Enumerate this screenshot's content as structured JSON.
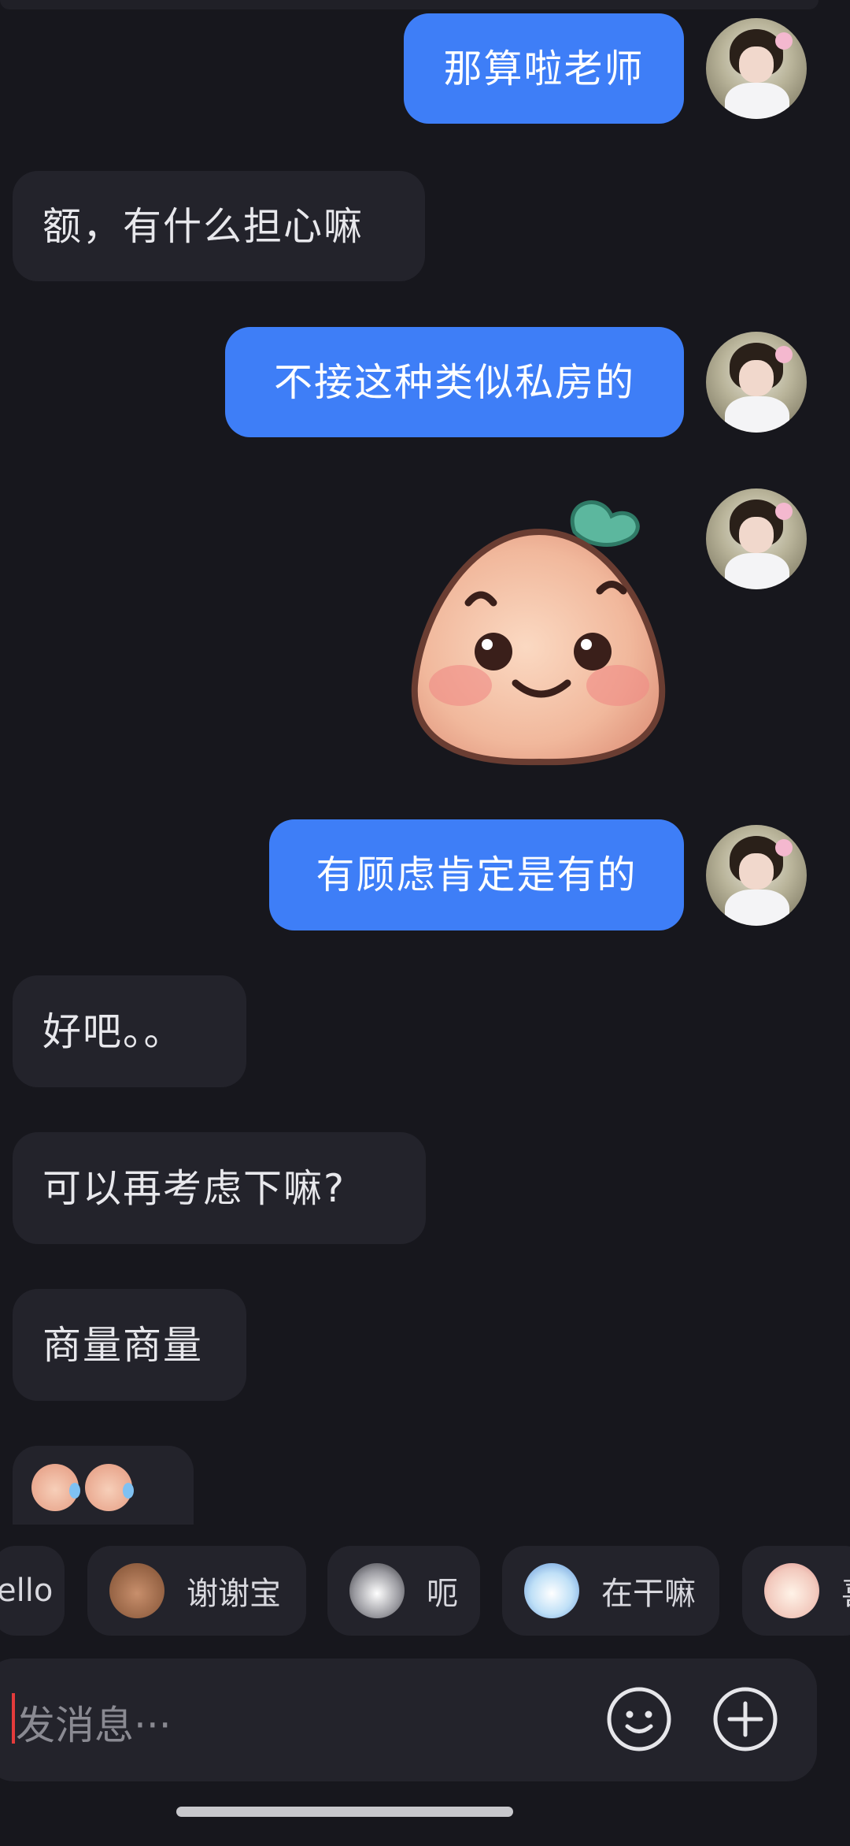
{
  "messages": {
    "m1": "那算啦老师",
    "m2": "额，有什么担心嘛",
    "m3": "不接这种类似私房的",
    "m4": "有顾虑肯定是有的",
    "m5": "好吧。。",
    "m6": "可以再考虑下嘛?",
    "m7": "商量商量"
  },
  "quick_replies": [
    "ello",
    "谢谢宝",
    "呃",
    "在干嘛",
    "喜"
  ],
  "input": {
    "placeholder": "发消息···"
  },
  "colors": {
    "outgoing": "#3e7ef7",
    "incoming": "#23232b",
    "background": "#17171d"
  }
}
